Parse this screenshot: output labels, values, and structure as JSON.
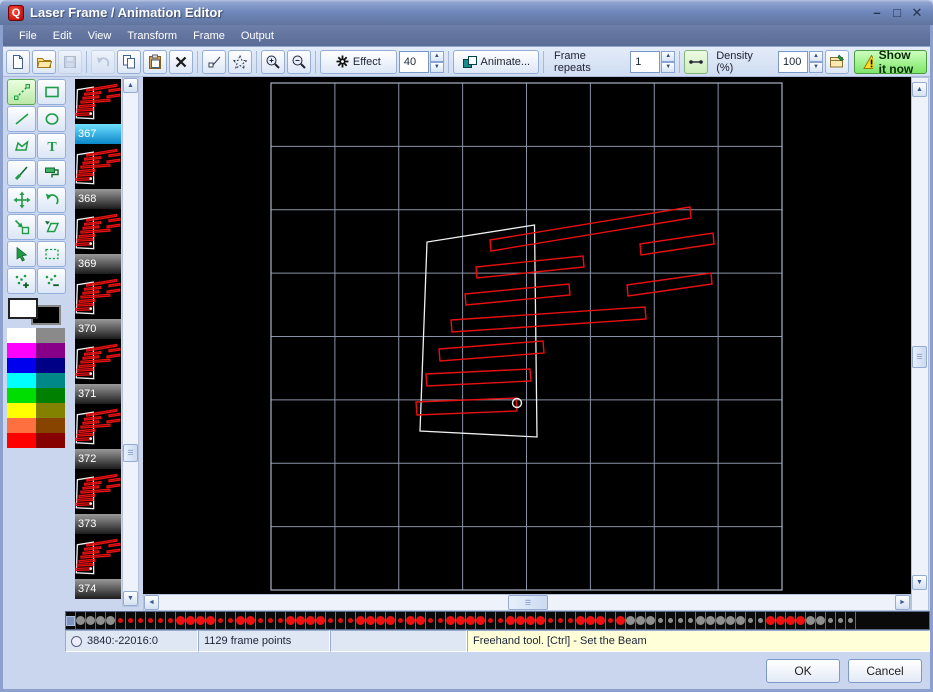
{
  "window": {
    "title": "Laser Frame / Animation Editor",
    "icon_letter": "Q"
  },
  "menu": {
    "items": [
      "File",
      "Edit",
      "View",
      "Transform",
      "Frame",
      "Output"
    ]
  },
  "toolbar": {
    "effect_label": "Effect",
    "effect_value": "40",
    "animate_label": "Animate...",
    "frame_repeats_label": "Frame repeats",
    "frame_repeats_value": "1",
    "density_label": "Density (%)",
    "density_value": "100",
    "show_it_now_label": "Show it now"
  },
  "tools": [
    "freehand",
    "rectangle",
    "line",
    "ellipse",
    "polygon",
    "text",
    "brush",
    "roller",
    "move",
    "rotate",
    "resize",
    "skew",
    "select",
    "rect-select",
    "add-points",
    "remove-points"
  ],
  "palette": {
    "foreground": "#ffffff",
    "background": "#000000",
    "left": [
      "#ffffff",
      "#ff00ff",
      "#0000ee",
      "#00ffff",
      "#00dd00",
      "#ffff00",
      "#ff7040",
      "#ff0000"
    ],
    "right": [
      "#8a8a8a",
      "#870087",
      "#000087",
      "#008787",
      "#008000",
      "#828200",
      "#874400",
      "#870000"
    ]
  },
  "frames": {
    "selected": "367",
    "items": [
      "367",
      "368",
      "369",
      "370",
      "371",
      "372",
      "373",
      "374"
    ]
  },
  "timeline": {
    "pattern": "BGGGGrrrrrrRRRRrrRRrrrRRRRrrrRRRRrRRrrRRRRrrRRRRrrrRRRrRGGGggggGGGGGggRRRRGGggg"
  },
  "status": {
    "coords": "3840:-22016:0",
    "points": "1129 frame points",
    "hint": "Freehand tool. [Ctrl] - Set the Beam"
  },
  "footer": {
    "ok": "OK",
    "cancel": "Cancel"
  },
  "colors": {
    "laser_red": "#e81010",
    "laser_white": "#f0f0f0",
    "grid": "#8a93a6",
    "accent_green": "#7fe669"
  }
}
